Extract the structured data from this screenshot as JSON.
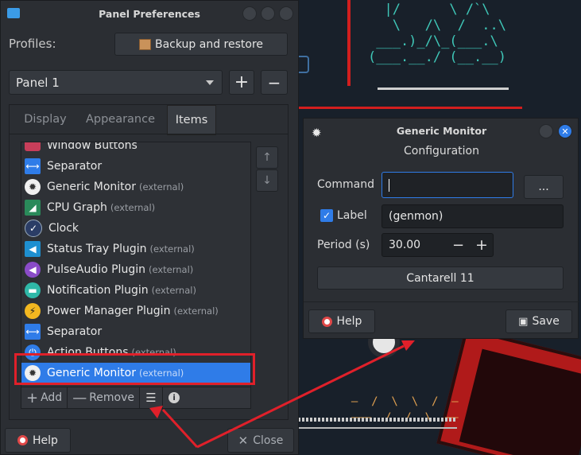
{
  "panel_prefs": {
    "title": "Panel Preferences",
    "profiles_label": "Profiles:",
    "backup_button": "Backup and restore",
    "panel_select": "Panel 1",
    "add_panel": "+",
    "remove_panel": "−",
    "tabs": [
      "Display",
      "Appearance",
      "Items"
    ],
    "items": [
      {
        "label": "Window Buttons",
        "ext": ""
      },
      {
        "label": "Separator",
        "ext": ""
      },
      {
        "label": "Generic Monitor",
        "ext": "(external)"
      },
      {
        "label": "CPU Graph",
        "ext": "(external)"
      },
      {
        "label": "Clock",
        "ext": ""
      },
      {
        "label": "Status Tray Plugin",
        "ext": "(external)"
      },
      {
        "label": "PulseAudio Plugin",
        "ext": "(external)"
      },
      {
        "label": "Notification Plugin",
        "ext": "(external)"
      },
      {
        "label": "Power Manager Plugin",
        "ext": "(external)"
      },
      {
        "label": "Separator",
        "ext": ""
      },
      {
        "label": "Action Buttons",
        "ext": "(external)"
      },
      {
        "label": "Generic Monitor",
        "ext": "(external)"
      }
    ],
    "add_item": "Add",
    "remove_item": "Remove",
    "help_button": "Help",
    "close_button": "Close"
  },
  "genmon": {
    "title": "Generic Monitor",
    "subtitle": "Configuration",
    "command_label": "Command",
    "command_value": "",
    "browse_button": "...",
    "label_label": "Label",
    "label_value": "(genmon)",
    "period_label": "Period (s)",
    "period_value": "30.00",
    "font_button": "Cantarell 11",
    "help_button": "Help",
    "save_button": "Save"
  },
  "colors": {
    "accent": "#2f7ce8",
    "highlight_box": "#e0202a",
    "window_bg": "#2b2e33"
  }
}
